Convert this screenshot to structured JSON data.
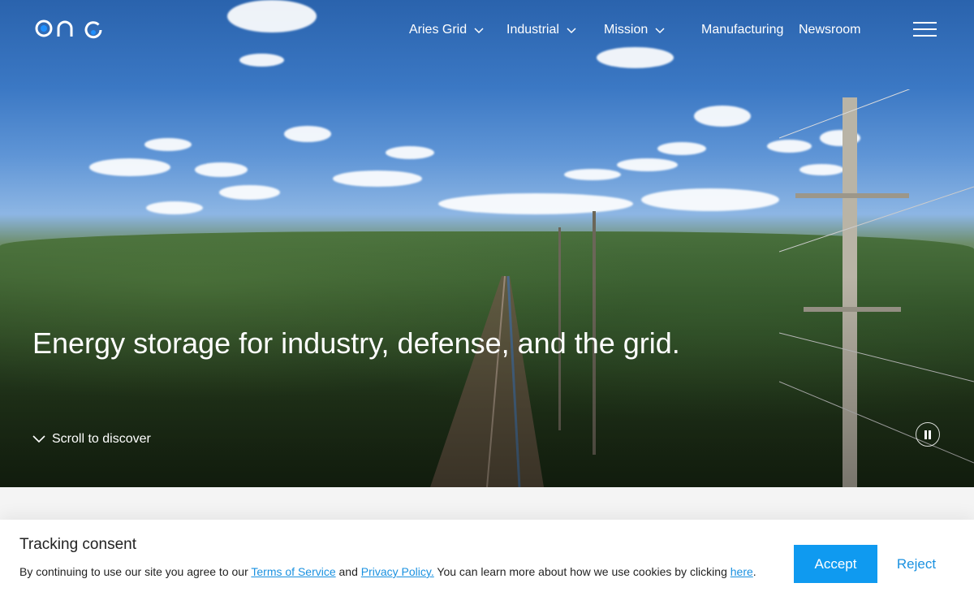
{
  "brand": {
    "logo_text": "one",
    "accent": "#0f9af0"
  },
  "nav": {
    "items": [
      {
        "label": "Aries Grid",
        "has_dropdown": true
      },
      {
        "label": "Industrial",
        "has_dropdown": true
      },
      {
        "label": "Mission",
        "has_dropdown": true
      },
      {
        "label": "Manufacturing",
        "has_dropdown": false
      },
      {
        "label": "Newsroom",
        "has_dropdown": false
      }
    ],
    "menu_icon": "hamburger-icon"
  },
  "hero": {
    "headline": "Energy storage for industry, defense, and the grid.",
    "scroll_label": "Scroll to discover",
    "scroll_icon": "chevron-down-icon",
    "pause_icon": "pause-icon"
  },
  "consent": {
    "title": "Tracking consent",
    "text_1": "By continuing to use our site you agree to our ",
    "terms_link": "Terms of Service",
    "text_2": " and ",
    "privacy_link": "Privacy Policy.",
    "text_3": " You can learn more about how we use cookies by clicking ",
    "here_link": "here",
    "text_4": ".",
    "accept_label": "Accept",
    "reject_label": "Reject"
  }
}
